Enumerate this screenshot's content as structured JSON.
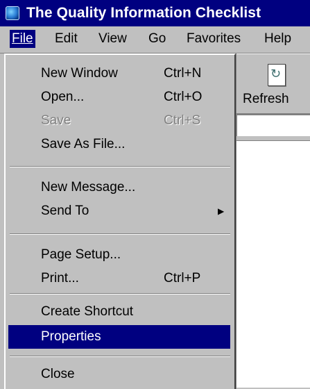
{
  "window": {
    "title": "The Quality Information Checklist"
  },
  "menubar": {
    "file": "File",
    "edit": "Edit",
    "view": "View",
    "go": "Go",
    "favorites": "Favorites",
    "help": "Help"
  },
  "toolbar": {
    "refresh_label": "Refresh"
  },
  "file_menu": {
    "new_window": "New Window",
    "new_window_shortcut": "Ctrl+N",
    "open": "Open...",
    "open_shortcut": "Ctrl+O",
    "save": "Save",
    "save_shortcut": "Ctrl+S",
    "save_as": "Save As File...",
    "new_message": "New Message...",
    "send_to": "Send To",
    "page_setup": "Page Setup...",
    "print": "Print...",
    "print_shortcut": "Ctrl+P",
    "create_shortcut": "Create Shortcut",
    "properties": "Properties",
    "close": "Close"
  }
}
